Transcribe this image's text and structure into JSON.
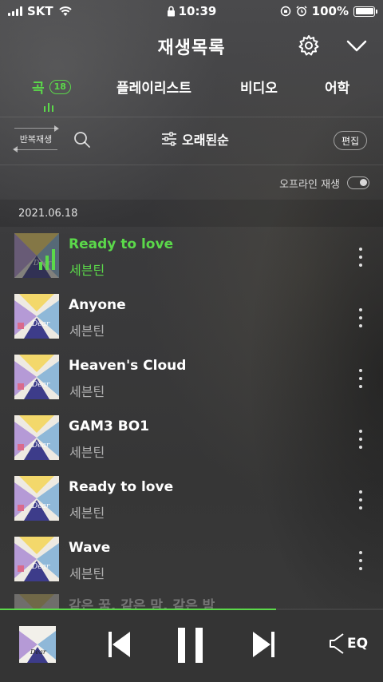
{
  "status_bar": {
    "carrier": "SKT",
    "time": "10:39",
    "battery": "100%",
    "battery_level": 1.0
  },
  "header": {
    "title": "재생목록",
    "settings_icon": "gear-icon",
    "collapse_icon": "chevron-down-icon"
  },
  "tabs": [
    {
      "label": "곡",
      "count": "18",
      "active": true
    },
    {
      "label": "플레이리스트",
      "active": false
    },
    {
      "label": "비디오",
      "active": false
    },
    {
      "label": "어학",
      "active": false
    }
  ],
  "toolbar": {
    "repeat_label": "반복재생",
    "sort_label": "오래된순",
    "edit_label": "편집"
  },
  "offline": {
    "label": "오프라인 재생",
    "enabled": false
  },
  "section_date": "2021.06.18",
  "songs": [
    {
      "title": "Ready to love",
      "artist": "세븐틴",
      "playing": true
    },
    {
      "title": "Anyone",
      "artist": "세븐틴",
      "playing": false
    },
    {
      "title": "Heaven's Cloud",
      "artist": "세븐틴",
      "playing": false
    },
    {
      "title": "GAM3 BO1",
      "artist": "세븐틴",
      "playing": false
    },
    {
      "title": "Ready to love",
      "artist": "세븐틴",
      "playing": false
    },
    {
      "title": "Wave",
      "artist": "세븐틴",
      "playing": false
    },
    {
      "title": "같은 꿈, 같은 맘, 같은 밤",
      "artist": "",
      "playing": false
    }
  ],
  "player": {
    "progress": 0.72,
    "eq_label": "EQ"
  },
  "colors": {
    "accent": "#5bd94a"
  }
}
